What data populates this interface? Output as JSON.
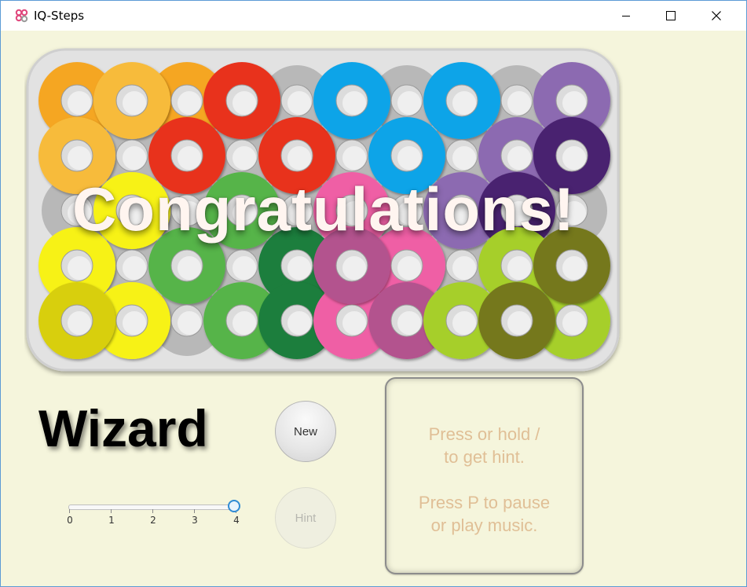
{
  "window": {
    "title": "IQ-Steps",
    "icon": "app-pieces-icon",
    "controls": [
      "minimize-icon",
      "maximize-icon",
      "close-icon"
    ]
  },
  "board": {
    "message": "Congratulations!",
    "rows": 5,
    "cols": 10,
    "base_color": "#dcdcdc",
    "peg_color": "#b8b8b8",
    "pieces_top": [
      {
        "color": "#f5a623",
        "cells": [
          [
            0,
            0
          ],
          [
            0,
            2
          ]
        ]
      },
      {
        "color": "#f7bb3a",
        "cells": [
          [
            0,
            1
          ],
          [
            1,
            0
          ]
        ]
      },
      {
        "color": "#e8321e",
        "cells": [
          [
            0,
            3
          ],
          [
            1,
            2
          ],
          [
            1,
            4
          ]
        ]
      },
      {
        "color": "#0aa4e8",
        "cells": [
          [
            0,
            5
          ],
          [
            0,
            7
          ],
          [
            1,
            6
          ]
        ]
      },
      {
        "color": "#8c6bb1",
        "cells": [
          [
            0,
            9
          ],
          [
            1,
            8
          ],
          [
            2,
            7
          ]
        ]
      },
      {
        "color": "#4a2370",
        "cells": [
          [
            1,
            9
          ],
          [
            2,
            8
          ]
        ]
      },
      {
        "color": "#f7f213",
        "cells": [
          [
            2,
            1
          ],
          [
            3,
            0
          ],
          [
            4,
            1
          ]
        ]
      },
      {
        "color": "#56b44a",
        "cells": [
          [
            2,
            3
          ],
          [
            3,
            2
          ],
          [
            4,
            3
          ]
        ]
      },
      {
        "color": "#1f7e3c",
        "cells": [
          [
            3,
            4
          ],
          [
            4,
            4
          ]
        ]
      },
      {
        "color": "#ef5fa5",
        "cells": [
          [
            2,
            5
          ],
          [
            3,
            6
          ],
          [
            4,
            5
          ]
        ]
      },
      {
        "color": "#b3528e",
        "cells": [
          [
            3,
            5
          ],
          [
            4,
            6
          ]
        ]
      },
      {
        "color": "#a6cf2a",
        "cells": [
          [
            3,
            8
          ],
          [
            4,
            7
          ],
          [
            4,
            9
          ]
        ]
      },
      {
        "color": "#74781d",
        "cells": [
          [
            3,
            9
          ],
          [
            4,
            8
          ]
        ]
      },
      {
        "color": "#d8cf10",
        "cells": [
          [
            4,
            0
          ]
        ]
      }
    ]
  },
  "level": {
    "name": "Wizard",
    "slider_value": 4,
    "slider_ticks": [
      "0",
      "1",
      "2",
      "3",
      "4"
    ]
  },
  "buttons": {
    "new_label": "New",
    "hint_label": "Hint"
  },
  "hint_panel": {
    "lines": [
      "Press or hold /",
      "to get hint.",
      "",
      "Press P to pause",
      "or play music."
    ]
  },
  "colors": {
    "background": "#f5f5dc",
    "slider_accent": "#2f8bd4",
    "hint_text": "#e0bf96"
  }
}
